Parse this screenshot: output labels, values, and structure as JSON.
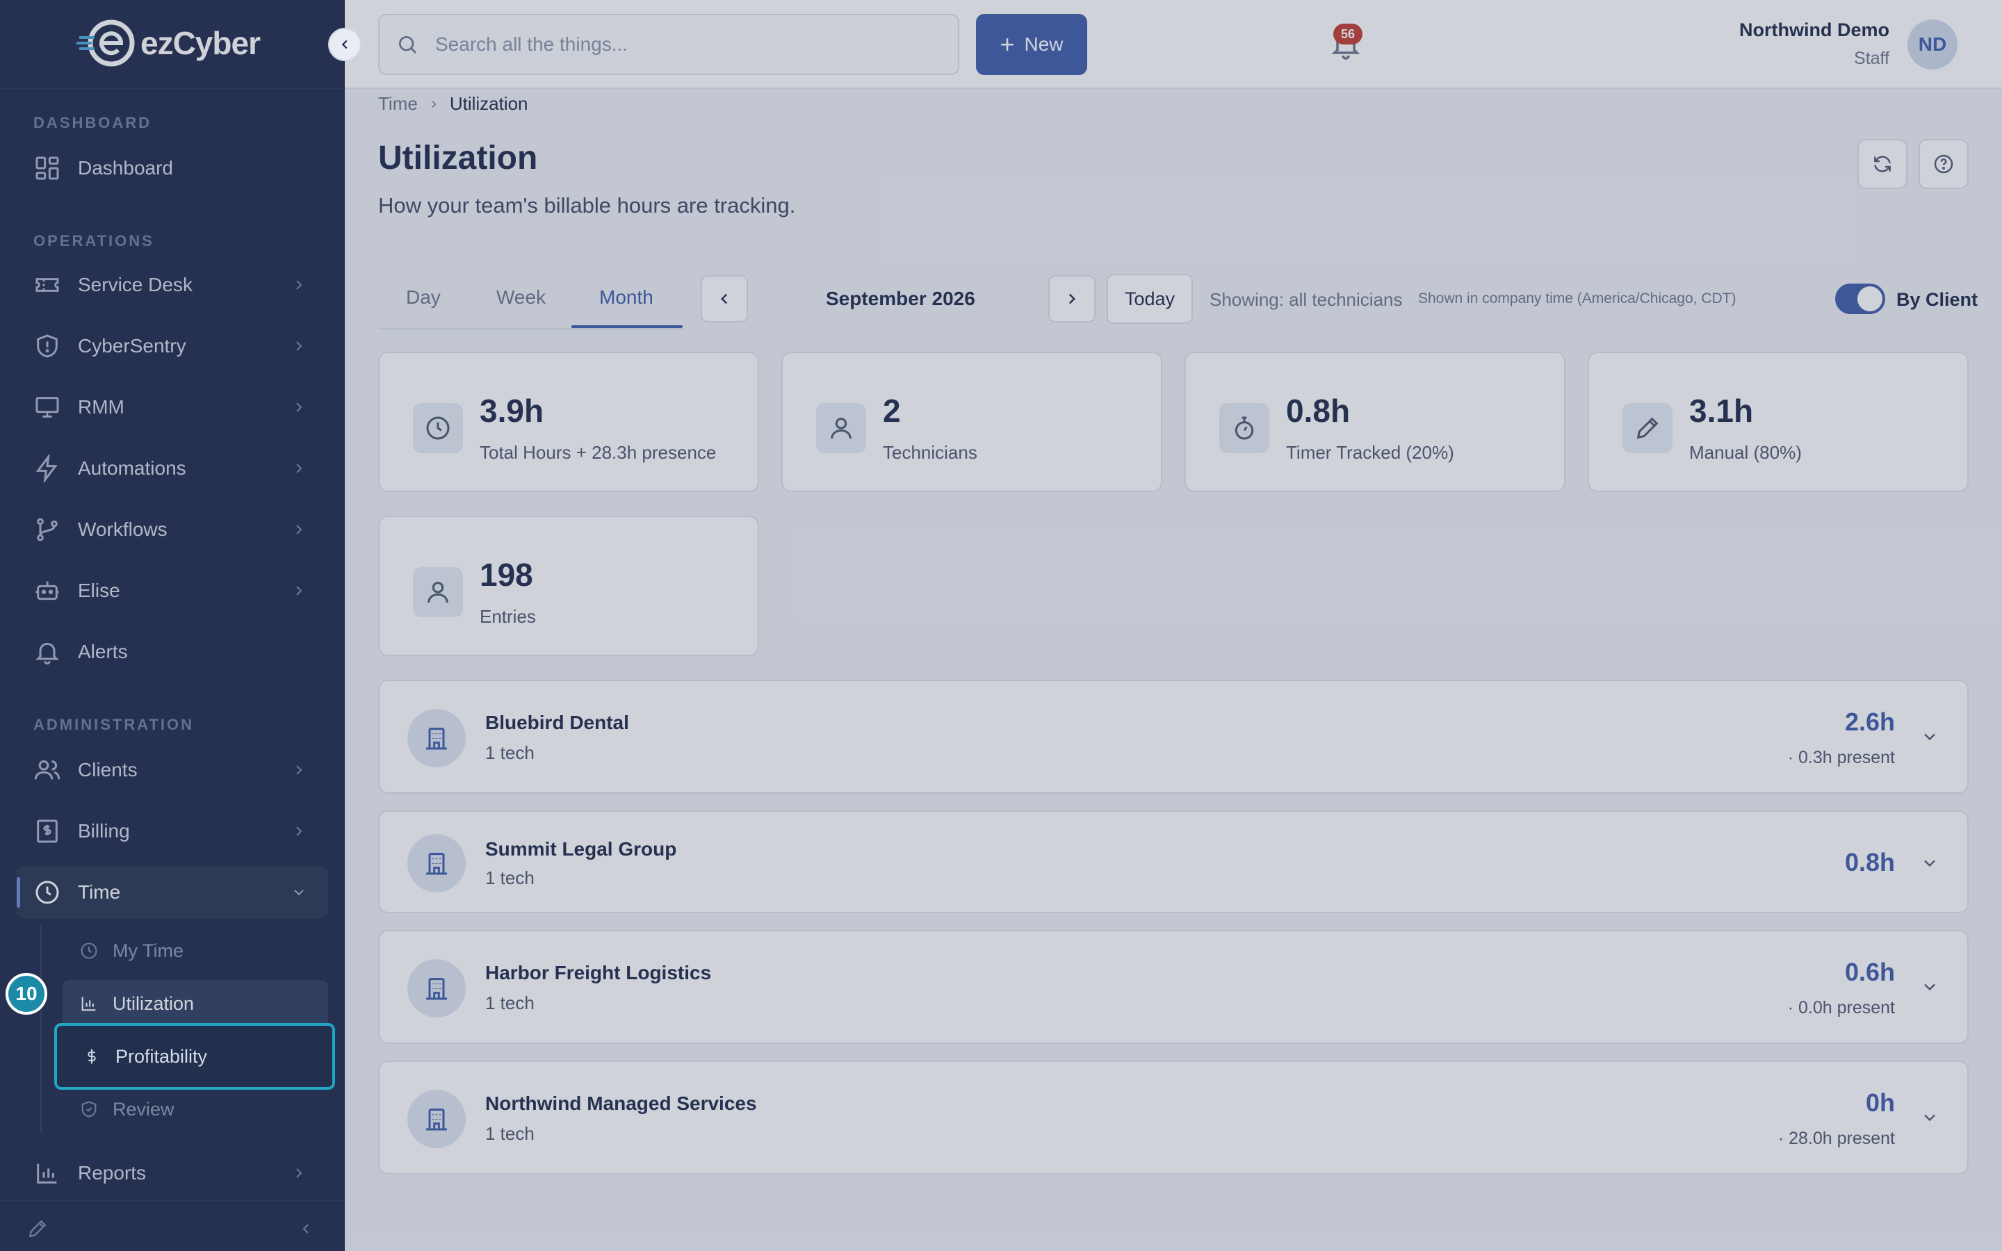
{
  "app": {
    "logo_text": "ezCyber",
    "brand_color": "#3a5aa8"
  },
  "sidebar": {
    "sections": {
      "dashboard": "DASHBOARD",
      "operations": "OPERATIONS",
      "administration": "ADMINISTRATION"
    },
    "items": {
      "dashboard": {
        "label": "Dashboard",
        "icon": "grid-icon"
      },
      "service_desk": {
        "label": "Service Desk",
        "icon": "ticket-icon"
      },
      "cybersentry": {
        "label": "CyberSentry",
        "icon": "shield-icon"
      },
      "rmm": {
        "label": "RMM",
        "icon": "monitor-icon"
      },
      "automations": {
        "label": "Automations",
        "icon": "bolt-icon"
      },
      "workflows": {
        "label": "Workflows",
        "icon": "branch-icon"
      },
      "elise": {
        "label": "Elise",
        "icon": "robot-icon"
      },
      "alerts": {
        "label": "Alerts",
        "icon": "bell-icon"
      },
      "clients": {
        "label": "Clients",
        "icon": "users-icon"
      },
      "billing": {
        "label": "Billing",
        "icon": "invoice-icon"
      },
      "time": {
        "label": "Time",
        "icon": "clock-icon"
      },
      "reports": {
        "label": "Reports",
        "icon": "bar-chart-icon"
      }
    },
    "time_sub": {
      "my_time": "My Time",
      "utilization": "Utilization",
      "profitability": "Profitability",
      "review": "Review"
    },
    "step_badge": "10"
  },
  "topbar": {
    "search_placeholder": "Search all the things...",
    "new_label": "New",
    "notification_count": "56",
    "user_name": "Northwind Demo",
    "user_role": "Staff",
    "avatar_initials": "ND"
  },
  "page": {
    "breadcrumb": [
      "Time",
      "Utilization"
    ],
    "title": "Utilization",
    "subtitle": "How your team's billable hours are tracking.",
    "tabs": [
      "Day",
      "Week",
      "Month"
    ],
    "active_tab": "Month",
    "period": "September 2026",
    "today_label": "Today",
    "showing": "Showing: all technicians",
    "tz_note": "Shown in company time (America/Chicago, CDT)",
    "toggle_label": "By Client",
    "toggle_on": true
  },
  "stats": [
    {
      "value": "3.9h",
      "label": "Total Hours + 28.3h presence",
      "icon": "clock-icon"
    },
    {
      "value": "2",
      "label": "Technicians",
      "icon": "user-icon"
    },
    {
      "value": "0.8h",
      "label": "Timer Tracked (20%)",
      "icon": "stopwatch-icon"
    },
    {
      "value": "3.1h",
      "label": "Manual (80%)",
      "icon": "pencil-icon"
    },
    {
      "value": "198",
      "label": "Entries",
      "icon": "user-icon"
    }
  ],
  "clients": [
    {
      "name": "Bluebird Dental",
      "techs": "1 tech",
      "hours": "2.6h",
      "present": "· 0.3h present"
    },
    {
      "name": "Summit Legal Group",
      "techs": "1 tech",
      "hours": "0.8h",
      "present": ""
    },
    {
      "name": "Harbor Freight Logistics",
      "techs": "1 tech",
      "hours": "0.6h",
      "present": "· 0.0h present"
    },
    {
      "name": "Northwind Managed Services",
      "techs": "1 tech",
      "hours": "0h",
      "present": "· 28.0h present"
    }
  ]
}
